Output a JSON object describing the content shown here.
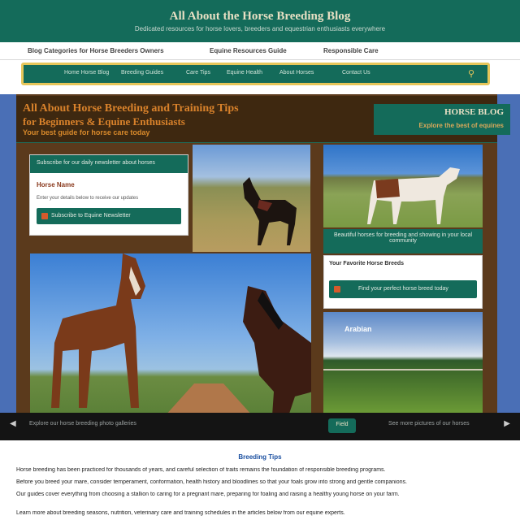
{
  "header": {
    "title": "All About the Horse Breeding Blog",
    "tagline": "Dedicated resources for horse lovers, breeders and equestrian enthusiasts everywhere"
  },
  "topnav": {
    "items": [
      "Blog Categories for Horse Breeders Owners",
      "Equine Resources Guide",
      "Responsible Care"
    ]
  },
  "searchbar": {
    "items": [
      "Home Horse Blog",
      "Breeding Guides",
      "Care Tips",
      "Equine Health",
      "About Horses",
      "Contact Us"
    ]
  },
  "hero": {
    "title_line1": "All About Horse Breeding and Training Tips",
    "title_line2": "for Beginners & Equine Enthusiasts",
    "title_line3": "Your best guide for horse care today",
    "right_title": "HORSE BLOG",
    "right_sub": "Explore the best of equines"
  },
  "card_left": {
    "header": "Subscribe for our daily newsletter about horses",
    "label": "Horse Name",
    "sub": "Enter your details below to receive our updates",
    "button": "Subscribe to Equine Newsletter"
  },
  "card_right": {
    "caption": "Beautiful horses for breeding and showing in your local community",
    "label": "Your Favorite Horse Breeds",
    "button": "Find your perfect horse breed today"
  },
  "photo_badge": "Arabian",
  "strip": {
    "left": "Explore our horse breeding photo galleries",
    "chip": "Field",
    "right": "See more pictures of our horses",
    "prev": "◀",
    "next": "▶"
  },
  "article": {
    "title": "Breeding Tips",
    "lines": [
      "Horse breeding has been practiced for thousands of years, and careful selection of traits remains the foundation of responsible breeding programs.",
      "Before you breed your mare, consider temperament, conformation, health history and bloodlines so that your foals grow into strong and gentle companions.",
      "Our guides cover everything from choosing a stallion to caring for a pregnant mare, preparing for foaling and raising a healthy young horse on your farm.",
      "Learn more about breeding seasons, nutrition, veterinary care and training schedules in the articles below from our equine experts."
    ]
  },
  "colors": {
    "primary": "#146b5a",
    "accent": "#e7c65a",
    "frame": "#5b3a1c",
    "heading_orange": "#d9822b"
  }
}
